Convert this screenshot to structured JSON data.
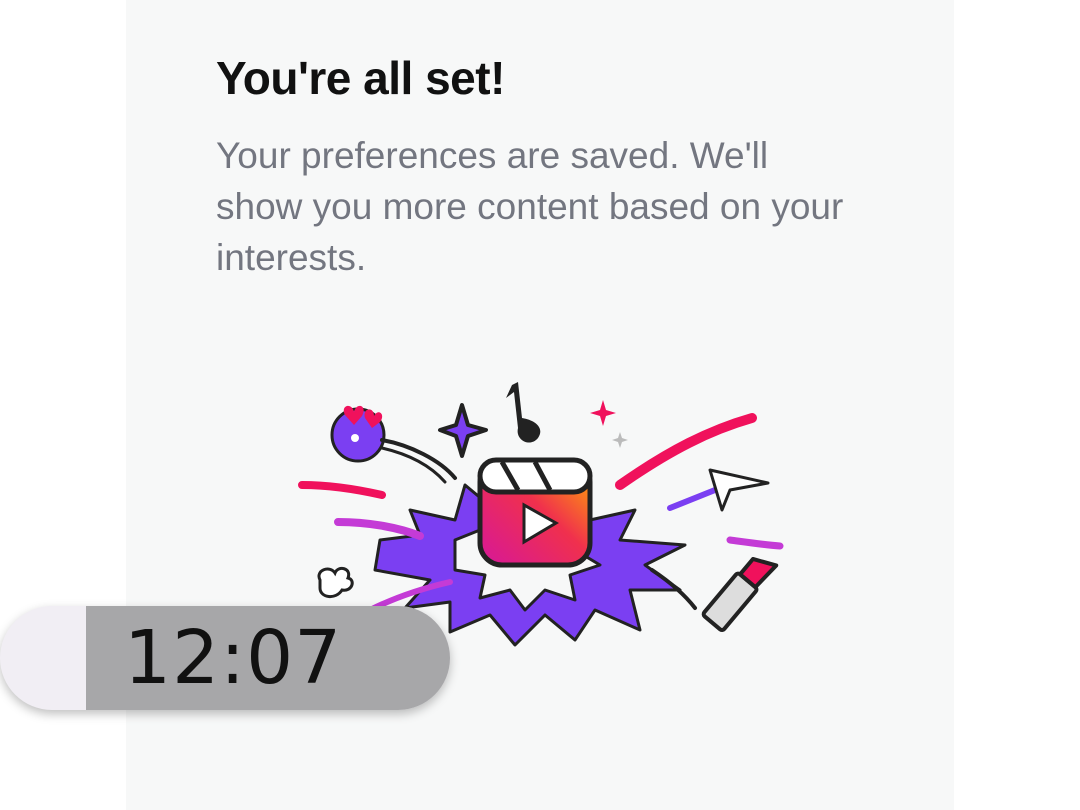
{
  "dialog": {
    "title": "You're all set!",
    "message": "Your preferences are saved. We'll show you more content based on your interests."
  },
  "illustration": {
    "icon": "reels-burst-illustration",
    "colors": {
      "burst": "#7b3ff2",
      "accent_pink": "#f0115c",
      "accent_orange": "#ff9a00"
    }
  },
  "overlay": {
    "clock_time": "12:07"
  },
  "colors": {
    "panel_background": "#f7f8f8",
    "title_text": "#111111",
    "message_text": "#737680"
  }
}
